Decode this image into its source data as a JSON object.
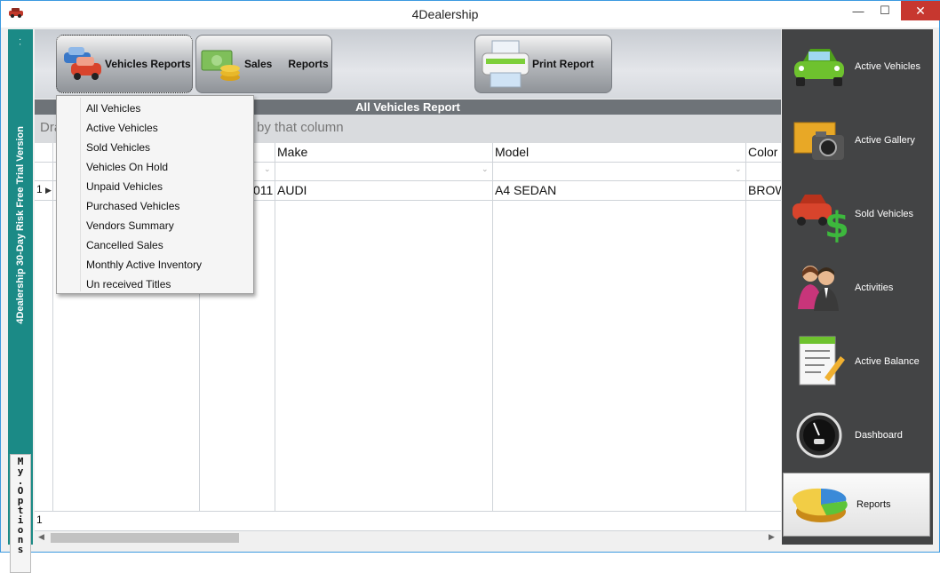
{
  "window": {
    "title": "4Dealership",
    "minimize_glyph": "—",
    "maximize_glyph": "☐",
    "close_glyph": "✕"
  },
  "left_strip": {
    "trial_text": "4Dealership 30-Day Risk Free Trial Version",
    "options_label": "My.Options",
    "dots": ". ."
  },
  "toolbar": {
    "vehicles_reports_label": "Vehicles Reports",
    "sales_label": "Sales",
    "reports_label": "Reports",
    "print_report_label": "Print Report"
  },
  "report": {
    "title": "All Vehicles Report",
    "group_hint_left": "Dra",
    "group_hint_right": "by that column",
    "columns": [
      "",
      "",
      "",
      "Make",
      "Model",
      "Color"
    ],
    "rows": [
      {
        "row_num": "1",
        "year_fragment": "011",
        "make": "AUDI",
        "model": "A4 SEDAN",
        "color": "BROW"
      }
    ],
    "footer_count": "1"
  },
  "menu": {
    "items": [
      "All Vehicles",
      "Active Vehicles",
      "Sold Vehicles",
      "Vehicles On Hold",
      "Unpaid Vehicles",
      "Purchased Vehicles",
      "Vendors Summary",
      "Cancelled Sales",
      "Monthly Active Inventory",
      "Un received Titles"
    ]
  },
  "right_nav": {
    "items": [
      {
        "label": "Active Vehicles",
        "icon": "green-car-icon"
      },
      {
        "label": "Active Gallery",
        "icon": "camera-icon"
      },
      {
        "label": "Sold Vehicles",
        "icon": "dollar-car-icon"
      },
      {
        "label": "Activities",
        "icon": "people-icon"
      },
      {
        "label": "Active Balance",
        "icon": "document-pencil-icon"
      },
      {
        "label": "Dashboard",
        "icon": "speedometer-icon"
      },
      {
        "label": "Reports",
        "icon": "pie-chart-icon"
      }
    ]
  },
  "colors": {
    "teal_strip": "#1b8a86",
    "nav_bg": "#434445",
    "close_red": "#c7372f",
    "report_header": "#6e7378"
  }
}
